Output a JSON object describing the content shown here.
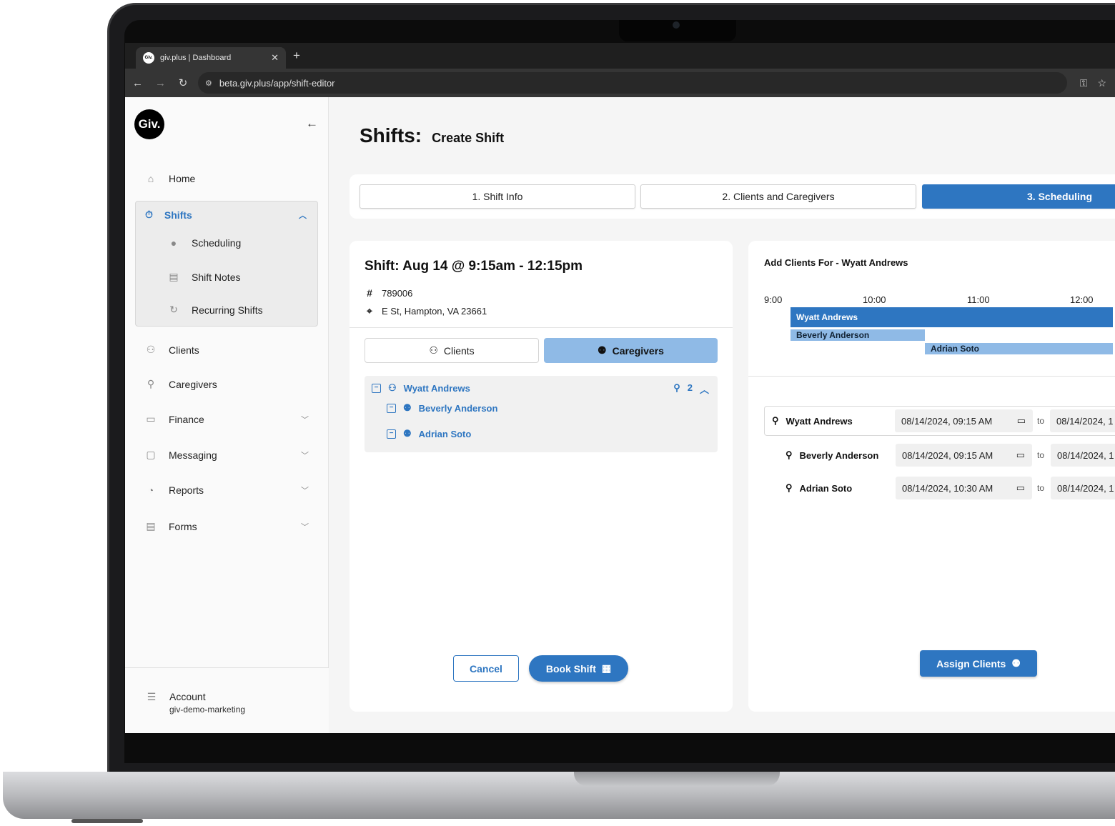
{
  "browser": {
    "tab_title": "giv.plus | Dashboard",
    "favicon_text": "Giv.",
    "url": "beta.giv.plus/app/shift-editor"
  },
  "sidebar": {
    "logo": "Giv.",
    "home": "Home",
    "shifts": "Shifts",
    "shifts_sub": [
      "Scheduling",
      "Shift Notes",
      "Recurring Shifts"
    ],
    "items": [
      "Clients",
      "Caregivers",
      "Finance",
      "Messaging",
      "Reports",
      "Forms"
    ],
    "account_label": "Account",
    "account_org": "giv-demo-marketing"
  },
  "page": {
    "title": "Shifts:",
    "subtitle": "Create Shift"
  },
  "steps": [
    "1. Shift Info",
    "2. Clients and Caregivers",
    "3. Scheduling"
  ],
  "shift": {
    "title": "Shift: Aug 14 @ 9:15am - 12:15pm",
    "id": "789006",
    "address": "E St, Hampton, VA 23661",
    "toggle_clients": "Clients",
    "toggle_caregivers": "Caregivers",
    "tree_root": "Wyatt Andrews",
    "tree_count": "2",
    "tree_children": [
      "Beverly Anderson",
      "Adrian Soto"
    ],
    "cancel": "Cancel",
    "book": "Book Shift"
  },
  "assign": {
    "title": "Add Clients For - Wyatt Andrews",
    "ticks": [
      "9:00",
      "10:00",
      "11:00",
      "12:00"
    ],
    "bars": [
      "Wyatt Andrews",
      "Beverly Anderson",
      "Adrian Soto"
    ],
    "rows": [
      {
        "name": "Wyatt Andrews",
        "start": "08/14/2024, 09:15 AM",
        "to": "to",
        "end": "08/14/2024, 1"
      },
      {
        "name": "Beverly Anderson",
        "start": "08/14/2024, 09:15 AM",
        "to": "to",
        "end": "08/14/2024, 1"
      },
      {
        "name": "Adrian Soto",
        "start": "08/14/2024, 10:30 AM",
        "to": "to",
        "end": "08/14/2024, 1"
      }
    ],
    "button": "Assign Clients"
  },
  "colors": {
    "accent": "#2e76c1",
    "accent_light": "#8fbae6"
  }
}
